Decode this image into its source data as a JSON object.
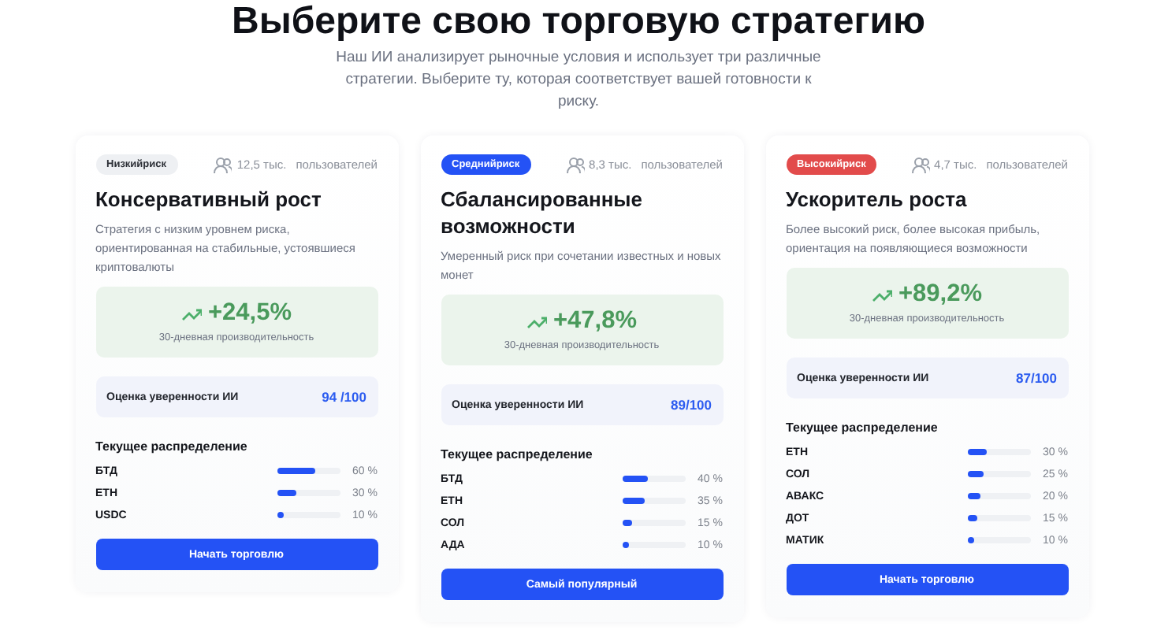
{
  "heading": "Выберите свою торговую стратегию",
  "subtitle": "Наш ИИ анализирует рыночные условия и использует три различные стратегии. Выберите ту, которая соответствует вашей готовности к риску.",
  "strategies": [
    {
      "kind": "low",
      "badge": "Низкийриск",
      "users": "12,5 тыс.",
      "users_label": "пользователей",
      "title": "Консервативный рост",
      "description": "Стратегия с низким уровнем риска, ориентированная на стабильные, устоявшиеся криптовалюты",
      "performance": "+24,5%",
      "performance_label": "30-дневная производительность",
      "confidence_label": "Оценка уверенности ИИ",
      "confidence": "94 /100",
      "allocation_title": "Текущее распределение",
      "allocation": [
        {
          "asset": "БТД",
          "level": 0.6,
          "percent": "60 %"
        },
        {
          "asset": "ETH",
          "level": 0.3,
          "percent": "30 %"
        },
        {
          "asset": "USDC",
          "level": 0.1,
          "percent": "10 %"
        }
      ],
      "button": "Начать торговлю"
    },
    {
      "kind": "medium",
      "badge": "Среднийриск",
      "users": "8,3 тыс.",
      "users_label": "пользователей",
      "title": "Сбалансированные возможности",
      "description": "Умеренный риск при сочетании известных и новых монет",
      "performance": "+47,8%",
      "performance_label": "30-дневная производительность",
      "confidence_label": "Оценка уверенности ИИ",
      "confidence": "89/100",
      "allocation_title": "Текущее распределение",
      "allocation": [
        {
          "asset": "БТД",
          "level": 0.4,
          "percent": "40 %"
        },
        {
          "asset": "ETH",
          "level": 0.35,
          "percent": "35 %"
        },
        {
          "asset": "СОЛ",
          "level": 0.15,
          "percent": "15 %"
        },
        {
          "asset": "АДА",
          "level": 0.1,
          "percent": "10 %"
        }
      ],
      "button": "Самый популярный"
    },
    {
      "kind": "high",
      "badge": "Высокийриск",
      "users": "4,7 тыс.",
      "users_label": "пользователей",
      "title": "Ускоритель роста",
      "description": "Более высокий риск, более высокая прибыль, ориентация на появляющиеся возможности",
      "performance": "+89,2%",
      "performance_label": "30-дневная производительность",
      "confidence_label": "Оценка уверенности ИИ",
      "confidence": "87/100",
      "allocation_title": "Текущее распределение",
      "allocation": [
        {
          "asset": "ETH",
          "level": 0.3,
          "percent": "30 %"
        },
        {
          "asset": "СОЛ",
          "level": 0.25,
          "percent": "25 %"
        },
        {
          "asset": "АВАКС",
          "level": 0.2,
          "percent": "20 %"
        },
        {
          "asset": "ДОТ",
          "level": 0.15,
          "percent": "15 %"
        },
        {
          "asset": "МАТИК",
          "level": 0.1,
          "percent": "10 %"
        }
      ],
      "button": "Начать торговлю"
    }
  ]
}
